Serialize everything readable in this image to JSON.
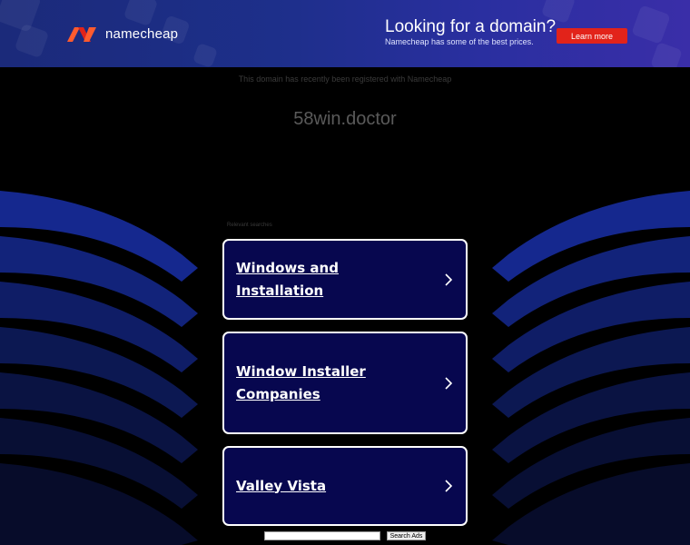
{
  "banner": {
    "logo_text": "namecheap",
    "promo_title": "Looking for a domain?",
    "promo_subtitle": "Namecheap has some of the best prices.",
    "learn_more": "Learn more",
    "accent_color": "#e2231a"
  },
  "notice": "This domain has recently been registered with Namecheap",
  "domain": "58win.doctor",
  "relevant": {
    "label": "Relevant searches",
    "items": [
      {
        "label": "Windows and Installation",
        "icon": "chevron-right-icon"
      },
      {
        "label": "Window Installer Companies",
        "icon": "chevron-right-icon"
      },
      {
        "label": "Valley Vista",
        "icon": "chevron-right-icon"
      }
    ]
  },
  "search": {
    "placeholder": "",
    "button": "Search Ads"
  }
}
